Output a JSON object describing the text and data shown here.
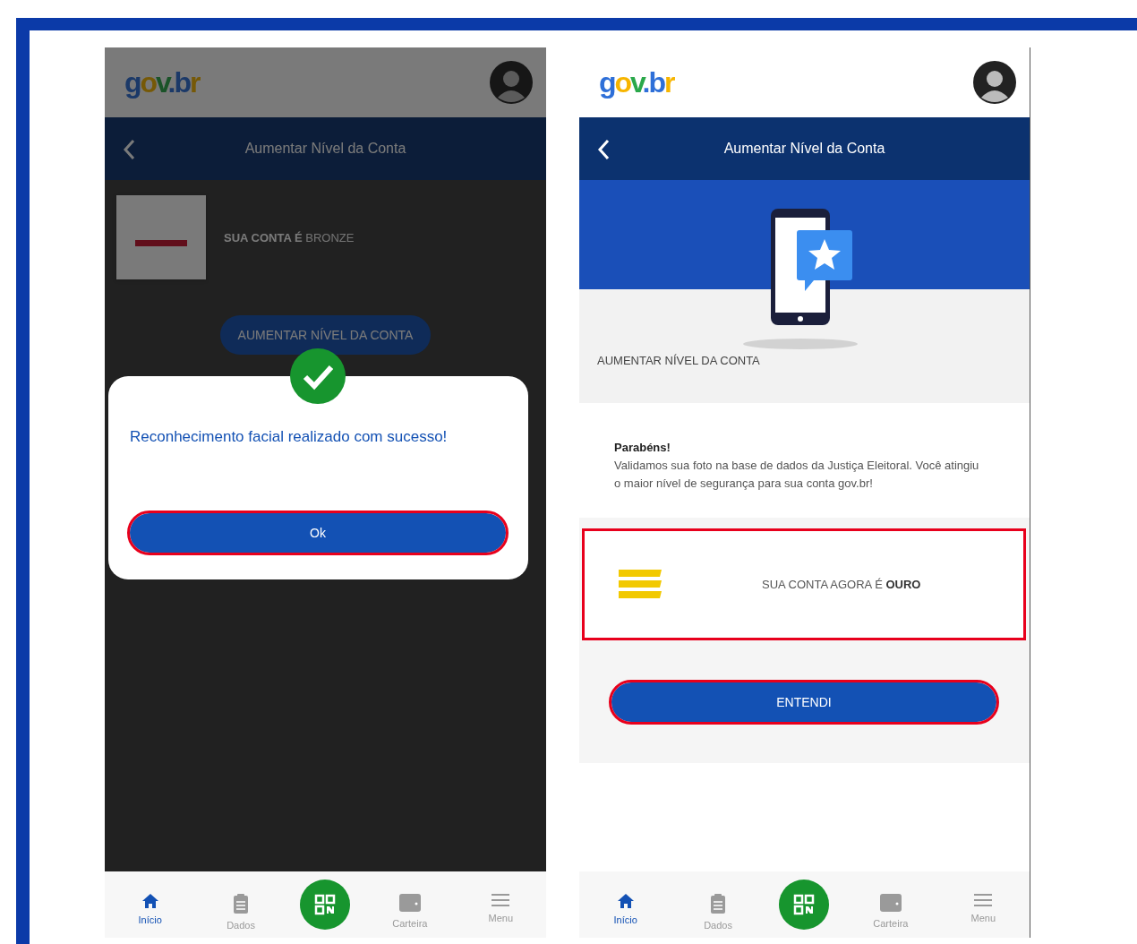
{
  "screens": [
    {
      "dimmed": true,
      "logo": "gov.br",
      "title": "Aumentar Nível da Conta",
      "account": {
        "kind": "bronze",
        "text": "**SUA CONTA É** BRONZE",
        "highlighted": false
      },
      "action_button": {
        "label": "AUMENTAR NÍVEL DA CONTA",
        "highlighted": false
      },
      "dialog": {
        "message": "Reconhecimento facial realizado com sucesso!",
        "button": {
          "label": "Ok",
          "highlighted": true
        }
      },
      "bottom_nav": [
        {
          "kind": "home",
          "label": "Início",
          "selected": true
        },
        {
          "kind": "clipboard",
          "label": "Dados",
          "selected": false
        },
        {
          "kind": "qr",
          "selected": false
        },
        {
          "kind": "wallet",
          "label": "Carteira",
          "selected": false
        },
        {
          "kind": "menu",
          "label": "Menu",
          "selected": false
        }
      ]
    },
    {
      "dimmed": false,
      "logo": "gov.br",
      "title": "Aumentar Nível da Conta",
      "section_label": "AUMENTAR NÍVEL DA CONTA",
      "message": {
        "heading": "Parabéns!",
        "body": "Validamos sua foto na base de dados da Justiça Eleitoral. Você atingiu o maior nível de segurança para sua conta gov.br!"
      },
      "account": {
        "kind": "gold",
        "text": "SUA CONTA AGORA É **OURO**",
        "highlighted": true
      },
      "action_button": {
        "label": "ENTENDI",
        "highlighted": true
      },
      "bottom_nav": [
        {
          "kind": "home",
          "label": "Início",
          "selected": true
        },
        {
          "kind": "clipboard",
          "label": "Dados",
          "selected": false
        },
        {
          "kind": "qr",
          "selected": false
        },
        {
          "kind": "wallet",
          "label": "Carteira",
          "selected": false
        },
        {
          "kind": "menu",
          "label": "Menu",
          "selected": false
        }
      ]
    }
  ]
}
